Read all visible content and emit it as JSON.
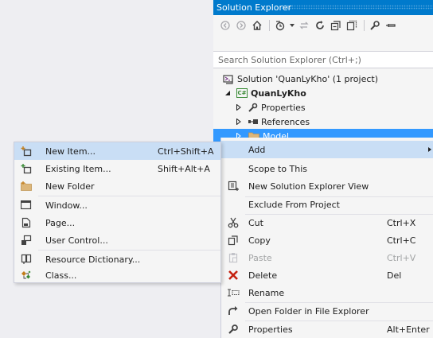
{
  "solution_explorer": {
    "title": "Solution Explorer",
    "search_placeholder": "Search Solution Explorer (Ctrl+;)",
    "toolbar_icons": [
      "back-icon",
      "forward-icon",
      "home-icon",
      "history-icon",
      "dropdown-icon",
      "sync-icon",
      "refresh-icon",
      "collapse-all-icon",
      "show-all-files-icon",
      "properties-icon",
      "pin-icon"
    ],
    "tree": {
      "solution": "Solution 'QuanLyKho' (1 project)",
      "project": "QuanLyKho",
      "project_badge": "C#",
      "properties": "Properties",
      "references": "References",
      "model": "Model"
    }
  },
  "context_menu": {
    "items": [
      {
        "label": "Add",
        "shortcut": ""
      },
      {
        "label": "Scope to This",
        "shortcut": ""
      },
      {
        "label": "New Solution Explorer View",
        "shortcut": ""
      },
      {
        "label": "Exclude From Project",
        "shortcut": ""
      },
      {
        "label": "Cut",
        "shortcut": "Ctrl+X"
      },
      {
        "label": "Copy",
        "shortcut": "Ctrl+C"
      },
      {
        "label": "Paste",
        "shortcut": "Ctrl+V"
      },
      {
        "label": "Delete",
        "shortcut": "Del"
      },
      {
        "label": "Rename",
        "shortcut": ""
      },
      {
        "label": "Open Folder in File Explorer",
        "shortcut": ""
      },
      {
        "label": "Properties",
        "shortcut": "Alt+Enter"
      }
    ]
  },
  "add_submenu": {
    "items": [
      {
        "label": "New Item...",
        "shortcut": "Ctrl+Shift+A"
      },
      {
        "label": "Existing Item...",
        "shortcut": "Shift+Alt+A"
      },
      {
        "label": "New Folder",
        "shortcut": ""
      },
      {
        "label": "Window...",
        "shortcut": ""
      },
      {
        "label": "Page...",
        "shortcut": ""
      },
      {
        "label": "User Control...",
        "shortcut": ""
      },
      {
        "label": "Resource Dictionary...",
        "shortcut": ""
      },
      {
        "label": "Class...",
        "shortcut": ""
      }
    ]
  },
  "colors": {
    "title_bar": "#007acc",
    "selection": "#3399ff",
    "menu_hover": "#c9def5",
    "menu_bg": "#f5f5f5",
    "disabled_text": "#a2a4a5"
  }
}
